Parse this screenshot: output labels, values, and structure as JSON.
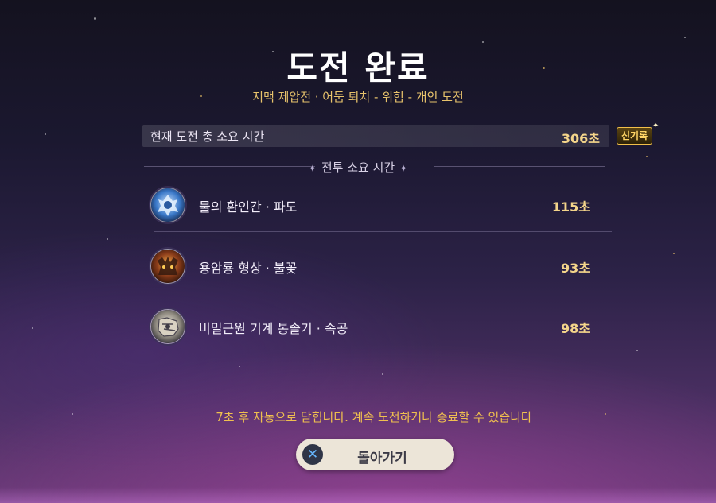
{
  "header": {
    "title": "도전 완료",
    "subtitle": "지맥 제압전 · 어둠 퇴치 - 위험 - 개인 도전"
  },
  "total": {
    "label": "현재 도전 총 소요 시간",
    "value": "306초",
    "badge": "신기록"
  },
  "section": {
    "label": "전투 소요 시간"
  },
  "battles": [
    {
      "name": "물의 환인간 · 파도",
      "time": "115초",
      "icon": "water-hypostasis-icon"
    },
    {
      "name": "용암룡 형상 · 불꽃",
      "time": "93초",
      "icon": "lava-dragon-statue-icon"
    },
    {
      "name": "비밀근원 기계 통솔기 · 속공",
      "time": "98초",
      "icon": "secret-source-automaton-icon"
    }
  ],
  "footer": {
    "auto_close": "7초 후 자동으로 닫힙니다. 계속 도전하거나 종료할 수 있습니다",
    "back_label": "돌아가기",
    "back_icon": "cross-button-icon"
  },
  "colors": {
    "accent_gold": "#f4d58a",
    "subtitle_gold": "#e8c36c",
    "button_bg": "#ece5d8"
  }
}
